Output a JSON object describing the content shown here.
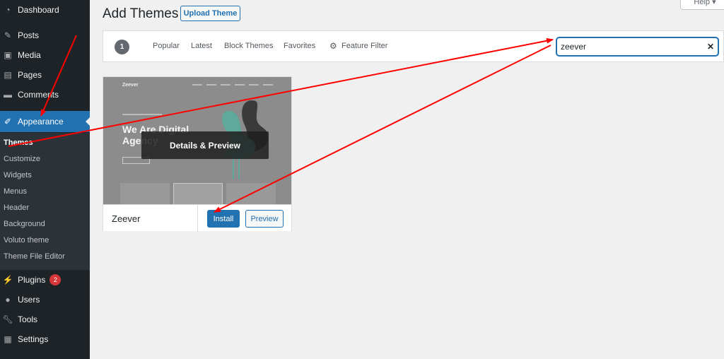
{
  "header": {
    "title": "Add Themes",
    "upload_label": "Upload Theme",
    "help_label": "Help ▾"
  },
  "sidebar": {
    "items": [
      {
        "label": "Dashboard",
        "icon": "dashboard-icon"
      },
      {
        "label": "Posts",
        "icon": "pin-icon"
      },
      {
        "label": "Media",
        "icon": "media-icon"
      },
      {
        "label": "Pages",
        "icon": "pages-icon"
      },
      {
        "label": "Comments",
        "icon": "comment-icon"
      },
      {
        "label": "Appearance",
        "icon": "brush-icon"
      },
      {
        "label": "Plugins",
        "icon": "plug-icon",
        "badge": "2"
      },
      {
        "label": "Users",
        "icon": "user-icon"
      },
      {
        "label": "Tools",
        "icon": "wrench-icon"
      },
      {
        "label": "Settings",
        "icon": "settings-icon"
      }
    ],
    "submenu": [
      "Themes",
      "Customize",
      "Widgets",
      "Menus",
      "Header",
      "Background",
      "Voluto theme",
      "Theme File Editor"
    ]
  },
  "filter_bar": {
    "count": "1",
    "links": [
      "Popular",
      "Latest",
      "Block Themes",
      "Favorites"
    ],
    "feature_filter": "Feature Filter",
    "search_value": "zeever",
    "clear_label": "✕"
  },
  "theme_card": {
    "name": "Zeever",
    "overlay_label": "Details & Preview",
    "install_label": "Install",
    "preview_label": "Preview",
    "screenshot": {
      "logo": "Zeever",
      "headline_line1": "We Are Digital",
      "headline_line2": "Agency"
    }
  },
  "colors": {
    "accent": "#2271b1",
    "sidebar_bg": "#1d2327",
    "annotation": "#ff0000"
  }
}
